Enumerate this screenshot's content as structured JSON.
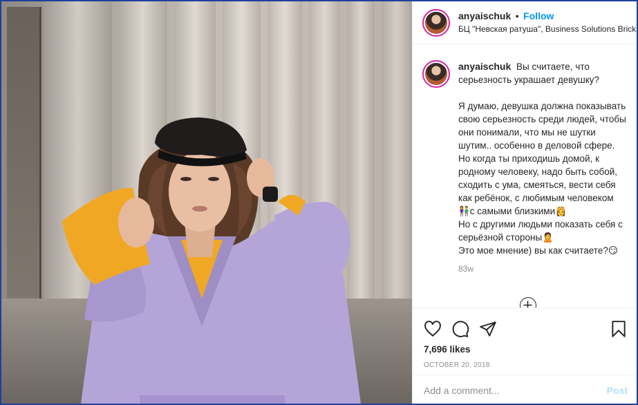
{
  "header": {
    "username": "anyaischuk",
    "separator": "•",
    "follow_label": "Follow",
    "location": "БЦ \"Невская ратуша\", Business Solutions Bricks"
  },
  "caption": {
    "username": "anyaischuk",
    "text": "Вы считаете, что серьезность украшает девушку?\n\nЯ думаю, девушка должна показывать свою серьезность среди людей, чтобы они понимали, что мы не шутки шутим.. особенно в деловой сфере.\nНо когда ты приходишь домой, к родному человеку, надо быть собой, сходить с ума, смеяться, вести себя как ребёнок, с любимым человеком 👫с самыми близкими👸\nНо с другими людьми показать себя с серьёзной стороны🙎\nЭто мое мнение) вы как считаете?😏",
    "age": "83w"
  },
  "actions": {
    "likes": "7,696 likes",
    "date": "OCTOBER 20, 2018"
  },
  "comment": {
    "placeholder": "Add a comment...",
    "post_label": "Post"
  },
  "colors": {
    "accent": "#0095f6",
    "post_disabled": "#b2dffc",
    "coat": "#b5a4d8",
    "clutch": "#f0a824"
  }
}
